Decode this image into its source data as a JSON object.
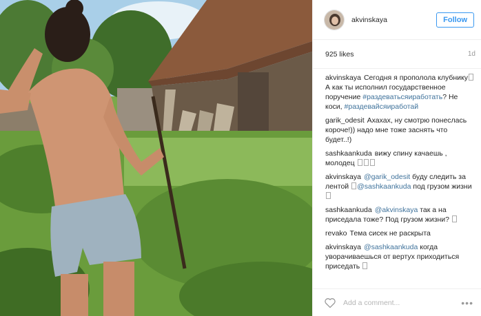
{
  "post": {
    "username": "akvinskaya",
    "follow_label": "Follow",
    "likes": "925 likes",
    "time": "1d",
    "add_comment_placeholder": "Add a comment...",
    "more_label": "•••"
  },
  "comments": [
    {
      "author": "akvinskaya",
      "parts": [
        {
          "t": "text",
          "v": "Сегодня я прополола клубнику"
        },
        {
          "t": "box"
        },
        {
          "t": "text",
          "v": "А как ты исполнил государственное поручение "
        },
        {
          "t": "tag",
          "v": "#раздеватьсяиработать"
        },
        {
          "t": "text",
          "v": "? Не коси, "
        },
        {
          "t": "tag",
          "v": "#раздевайсяиработай"
        }
      ]
    },
    {
      "author": "garik_odesit",
      "parts": [
        {
          "t": "text",
          "v": "Ахахах, ну смотрю понеслась короче!)) надо мне тоже заснять что будет..!)"
        }
      ]
    },
    {
      "author": "sashkaankuda",
      "parts": [
        {
          "t": "text",
          "v": "вижу спину качаешь , молодец "
        },
        {
          "t": "box"
        },
        {
          "t": "box"
        },
        {
          "t": "box"
        }
      ]
    },
    {
      "author": "akvinskaya",
      "parts": [
        {
          "t": "tag",
          "v": "@garik_odesit"
        },
        {
          "t": "text",
          "v": " буду следить за лентой "
        },
        {
          "t": "box"
        },
        {
          "t": "tag",
          "v": "@sashkaankuda"
        },
        {
          "t": "text",
          "v": " под грузом жизни "
        },
        {
          "t": "box"
        }
      ]
    },
    {
      "author": "sashkaankuda",
      "parts": [
        {
          "t": "tag",
          "v": "@akvinskaya"
        },
        {
          "t": "text",
          "v": " так а на приседала тоже? Под грузом жизни? "
        },
        {
          "t": "box"
        }
      ]
    },
    {
      "author": "revako",
      "parts": [
        {
          "t": "text",
          "v": "Тема сисек не раскрыта"
        }
      ]
    },
    {
      "author": "akvinskaya",
      "parts": [
        {
          "t": "tag",
          "v": "@sashkaankuda"
        },
        {
          "t": "text",
          "v": " когда уворачиваешься от вертух приходиться приседать "
        },
        {
          "t": "box"
        }
      ]
    }
  ],
  "colors": {
    "accent": "#3897f0",
    "link": "#3f729b",
    "muted": "#999999"
  }
}
